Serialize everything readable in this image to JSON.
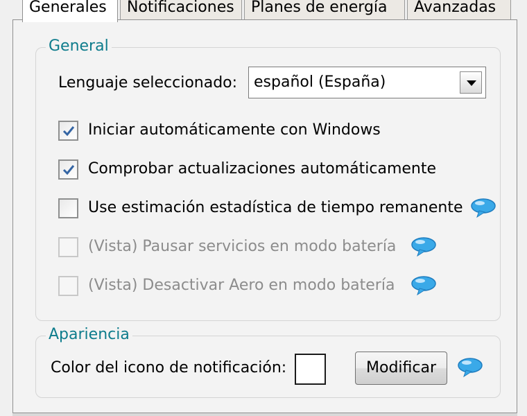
{
  "tabs": [
    {
      "label": "Generales",
      "active": true
    },
    {
      "label": "Notificaciones",
      "active": false
    },
    {
      "label": "Planes de energía",
      "active": false
    },
    {
      "label": "Avanzadas",
      "active": false
    }
  ],
  "general": {
    "title": "General",
    "language_label": "Lenguaje seleccionado:",
    "language_value": "español (España)",
    "options": [
      {
        "label": "Iniciar automáticamente con Windows",
        "checked": true,
        "enabled": true
      },
      {
        "label": "Comprobar actualizaciones automáticamente",
        "checked": true,
        "enabled": true
      },
      {
        "label": "Use estimación estadística de tiempo remanente",
        "checked": false,
        "enabled": true
      },
      {
        "label": "(Vista) Pausar servicios en modo batería",
        "checked": false,
        "enabled": false
      },
      {
        "label": "(Vista) Desactivar Aero en modo batería",
        "checked": false,
        "enabled": false
      }
    ]
  },
  "appearance": {
    "title": "Apariencia",
    "color_label": "Color del icono de notificación:",
    "color_value": "#ffffff",
    "modify_label": "Modificar"
  },
  "colors": {
    "accent": "#0e7c8c",
    "bubble": "#3aa9e8",
    "check": "#3465a4"
  },
  "icons": {
    "info": "speech-bubble-icon"
  }
}
